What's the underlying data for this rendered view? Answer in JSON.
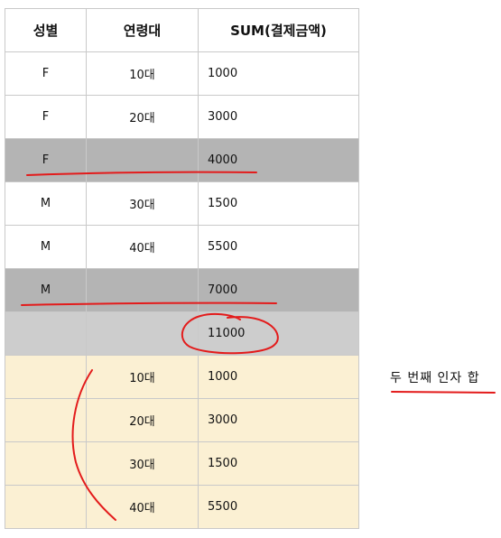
{
  "headers": [
    "성별",
    "연령대",
    "SUM(결제금액)"
  ],
  "rows": [
    {
      "gender": "F",
      "age": "10대",
      "sum": "1000"
    },
    {
      "gender": "F",
      "age": "20대",
      "sum": "3000"
    },
    {
      "gender": "F",
      "age": "",
      "sum": "4000"
    },
    {
      "gender": "M",
      "age": "30대",
      "sum": "1500"
    },
    {
      "gender": "M",
      "age": "40대",
      "sum": "5500"
    },
    {
      "gender": "M",
      "age": "",
      "sum": "7000"
    },
    {
      "gender": "",
      "age": "",
      "sum": "11000"
    },
    {
      "gender": "",
      "age": "10대",
      "sum": "1000"
    },
    {
      "gender": "",
      "age": "20대",
      "sum": "3000"
    },
    {
      "gender": "",
      "age": "30대",
      "sum": "1500"
    },
    {
      "gender": "",
      "age": "40대",
      "sum": "5500"
    }
  ],
  "annotation": "두 번째 인자 합",
  "colors": {
    "subtotal_row": "#b4b4b4",
    "grand_total_row": "#cdcdcd",
    "age_total_rows": "#fbf0d3",
    "ink": "#e31b1b"
  }
}
